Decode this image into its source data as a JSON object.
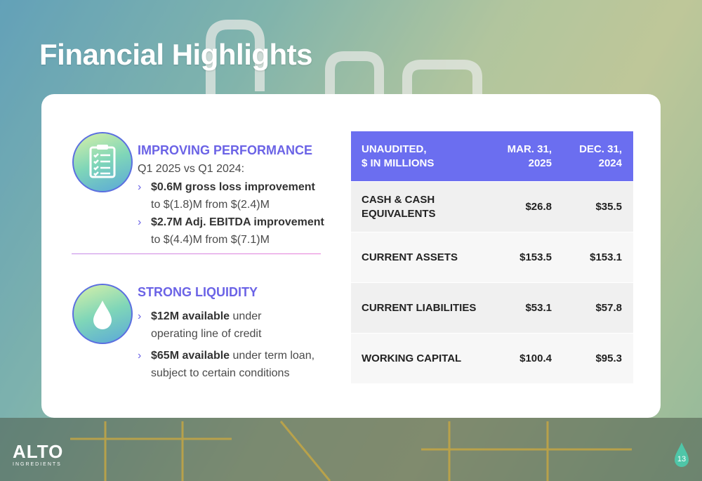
{
  "slide": {
    "title": "Financial Highlights",
    "page_number": "13"
  },
  "performance": {
    "icon": "checklist-icon",
    "heading": "IMPROVING PERFORMANCE",
    "subheading": "Q1 2025 vs  Q1 2024:",
    "bullets": [
      {
        "bold": "$0.6M gross loss improvement",
        "rest": "to $(1.8)M from $(2.4)M"
      },
      {
        "bold": "$2.7M Adj. EBITDA improvement",
        "rest": "to $(4.4)M from $(7.1)M"
      }
    ]
  },
  "liquidity": {
    "icon": "water-drop-icon",
    "heading": "STRONG LIQUIDITY",
    "bullets": [
      {
        "bold": "$12M available",
        "rest1": " under",
        "rest2": "operating line of credit"
      },
      {
        "bold": "$65M available",
        "rest1": " under term loan,",
        "rest2": "subject to certain conditions"
      }
    ]
  },
  "table": {
    "header": {
      "label_line1": "UNAUDITED,",
      "label_line2": "$ IN MILLIONS",
      "col1_line1": "MAR. 31,",
      "col1_line2": "2025",
      "col2_line1": "DEC. 31,",
      "col2_line2": "2024"
    },
    "rows": [
      {
        "label_line1": "CASH & CASH",
        "label_line2": "EQUIVALENTS",
        "mar": "$26.8",
        "dec": "$35.5"
      },
      {
        "label": "CURRENT ASSETS",
        "mar": "$153.5",
        "dec": "$153.1"
      },
      {
        "label": "CURRENT LIABILITIES",
        "mar": "$53.1",
        "dec": "$57.8"
      },
      {
        "label": "WORKING CAPITAL",
        "mar": "$100.4",
        "dec": "$95.3"
      }
    ]
  },
  "brand": {
    "logo_text": "ALTO",
    "logo_subtext": "INGREDIENTS",
    "accent_color": "#6b63e6",
    "header_color": "#6b6ef0"
  }
}
